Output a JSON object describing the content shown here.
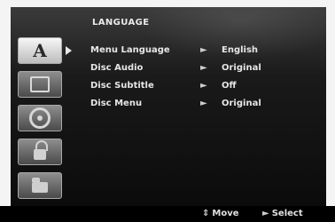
{
  "page": {
    "title": "LANGUAGE"
  },
  "sidebar": {
    "items": [
      {
        "name": "language",
        "glyph": "A"
      },
      {
        "name": "display"
      },
      {
        "name": "audio"
      },
      {
        "name": "lock"
      },
      {
        "name": "others"
      }
    ]
  },
  "menu": {
    "rows": [
      {
        "label": "Menu Language",
        "value": "English"
      },
      {
        "label": "Disc Audio",
        "value": "Original"
      },
      {
        "label": "Disc Subtitle",
        "value": "Off"
      },
      {
        "label": "Disc Menu",
        "value": "Original"
      }
    ],
    "arrow_glyph": "►"
  },
  "footer": {
    "move_icon": "⇕",
    "move_label": "Move",
    "select_icon": "►",
    "select_label": "Select"
  },
  "colors": {
    "text": "#e6e6e6",
    "background": "#0b0b0b"
  }
}
